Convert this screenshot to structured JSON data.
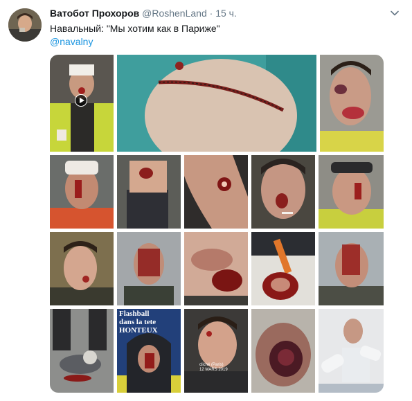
{
  "tweet": {
    "author_name": "Ватобот Прохоров",
    "author_handle": "@RoshenLand",
    "separator": "·",
    "time": "15 ч.",
    "text": "Навальный: \"Мы хотим как в Париже\"",
    "mention": "@navalny"
  },
  "icons": {
    "menu": "chevron-down-icon",
    "video": "play-icon"
  },
  "colors": {
    "link": "#1b95e0",
    "muted": "#657786",
    "text": "#14171a"
  },
  "photo_overlays": {
    "flashball_text": [
      "Flashball",
      "dans la tete",
      "HONTEUX"
    ],
    "paris_caption": [
      "cliché (Paris)",
      "12 MARS 2019"
    ]
  }
}
